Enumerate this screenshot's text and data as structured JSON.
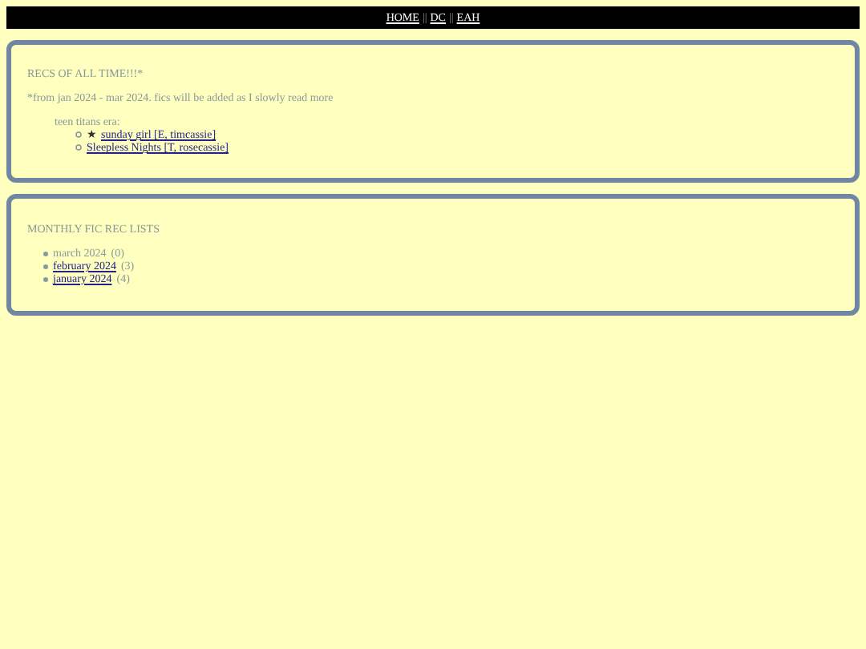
{
  "nav": {
    "links": [
      "HOME",
      "DC",
      "EAH"
    ],
    "separator": "||"
  },
  "recs": {
    "title": "RECS OF ALL TIME!!!*",
    "note": "*from jan 2024 - mar 2024. fics will be added as I slowly read more",
    "groups": [
      {
        "label": "teen titans era:",
        "items": [
          {
            "star": "★",
            "link": "sunday girl [E, timcassie]"
          },
          {
            "link": "Sleepless Nights [T, rosecassie]"
          }
        ]
      }
    ]
  },
  "monthly": {
    "title": "MONTHLY FIC REC LISTS",
    "items": [
      {
        "kind": "text",
        "label": "march 2024",
        "count": "(0)"
      },
      {
        "kind": "link",
        "label": "february 2024",
        "count": "(3)"
      },
      {
        "kind": "link",
        "label": "january 2024",
        "count": "(4)"
      }
    ]
  }
}
